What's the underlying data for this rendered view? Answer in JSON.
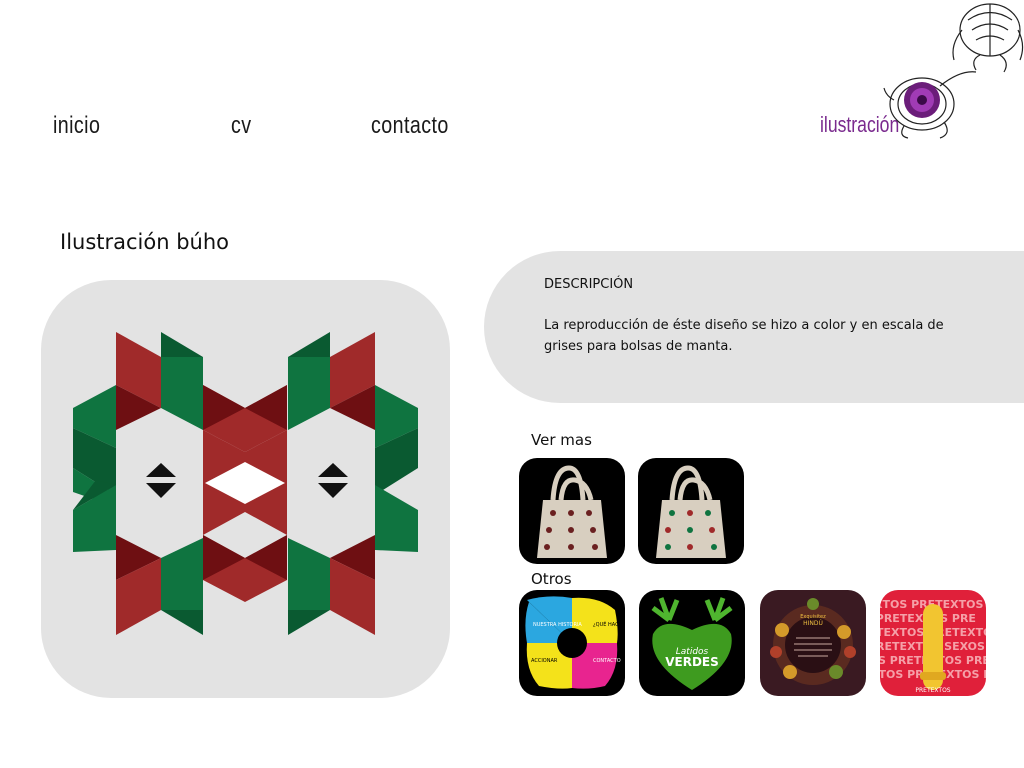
{
  "nav": {
    "items": [
      {
        "label": "inicio"
      },
      {
        "label": "cv"
      },
      {
        "label": "contacto"
      }
    ]
  },
  "brand": {
    "label": "ilustración"
  },
  "page": {
    "title": "Ilustración búho"
  },
  "description": {
    "heading": "DESCRIPCIÓN",
    "text": "La reproducción de éste diseño se hizo a color y en escala de grises para bolsas de manta."
  },
  "related": {
    "label": "Ver mas"
  },
  "others": {
    "label": "Otros",
    "items": [
      {
        "labels": [
          "NUESTRA HISTORIA",
          "¿QUÉ HACEMOS?",
          "ACCIONAR",
          "CONTACTO"
        ]
      },
      {
        "labels": [
          "Latidos",
          "VERDES"
        ]
      },
      {
        "labels": [
          "Exquisitez",
          "HINDÚ"
        ]
      },
      {
        "labels": [
          "PRETEXTOS"
        ]
      }
    ]
  },
  "colors": {
    "red": "#a02a2a",
    "dark_red": "#6e0f12",
    "green": "#0f7440",
    "dark_green": "#0a5a31",
    "panel": "#e3e3e3",
    "brand": "#7a2a8e"
  }
}
